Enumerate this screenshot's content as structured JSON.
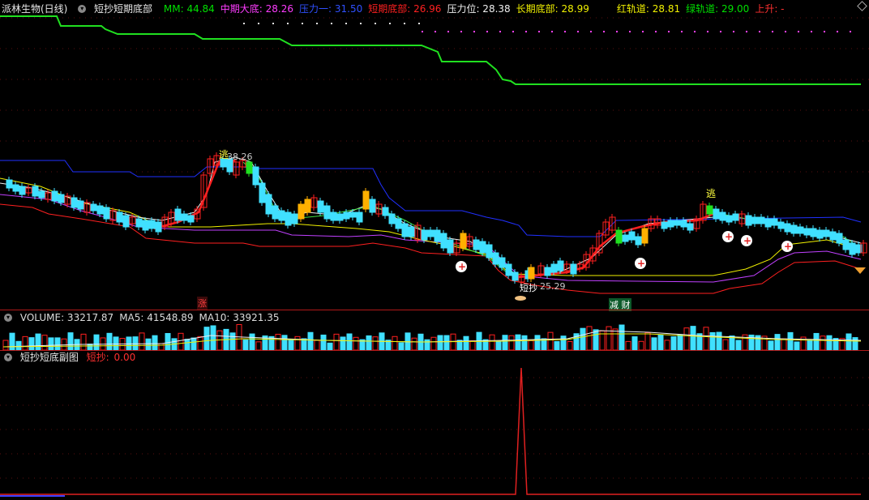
{
  "main_header": {
    "title": "派林生物(日线)",
    "indicator_name": "短抄短期底部",
    "fields": [
      {
        "label": "MM:",
        "value": "44.84",
        "color": "#00e000"
      },
      {
        "label": "中期大底:",
        "value": "28.26",
        "color": "#ff3cff"
      },
      {
        "label": "压力一:",
        "value": "31.50",
        "color": "#3050ff"
      },
      {
        "label": "短期底部:",
        "value": "26.96",
        "color": "#ff2020"
      },
      {
        "label": "压力位:",
        "value": "28.38",
        "color": "#f0f0f0"
      },
      {
        "label": "长期底部:",
        "value": "28.99",
        "color": "#f0f000"
      },
      {
        "label": "红轨道:",
        "value": "28.81",
        "color": "#f0f000"
      },
      {
        "label": "绿轨道:",
        "value": "29.00",
        "color": "#00e000"
      },
      {
        "label": "上升:",
        "value": "-",
        "color": "#ff3030"
      }
    ]
  },
  "chart_labels": {
    "peak_price": "38.26",
    "low_price": "25.29",
    "escape_1": "逃",
    "escape_2": "逃",
    "bottom_buy": "短抄",
    "rise_tag": "涨",
    "reduce_tag": "减 财"
  },
  "volume_header": {
    "fields": [
      {
        "label": "VOLUME:",
        "value": "33217.87",
        "color": "#dddddd"
      },
      {
        "label": "MA5:",
        "value": "41548.89",
        "color": "#dddddd"
      },
      {
        "label": "MA10:",
        "value": "33921.35",
        "color": "#dddddd"
      }
    ]
  },
  "sub_header": {
    "title": "短抄短底副图",
    "field": {
      "label": "短抄:",
      "value": "0.00",
      "color": "#ff3030"
    }
  },
  "colors": {
    "up": "#ff2020",
    "down": "#40e0ff",
    "special": "#ffb000",
    "green_candle": "#20e020",
    "divider": "#b01818"
  }
}
